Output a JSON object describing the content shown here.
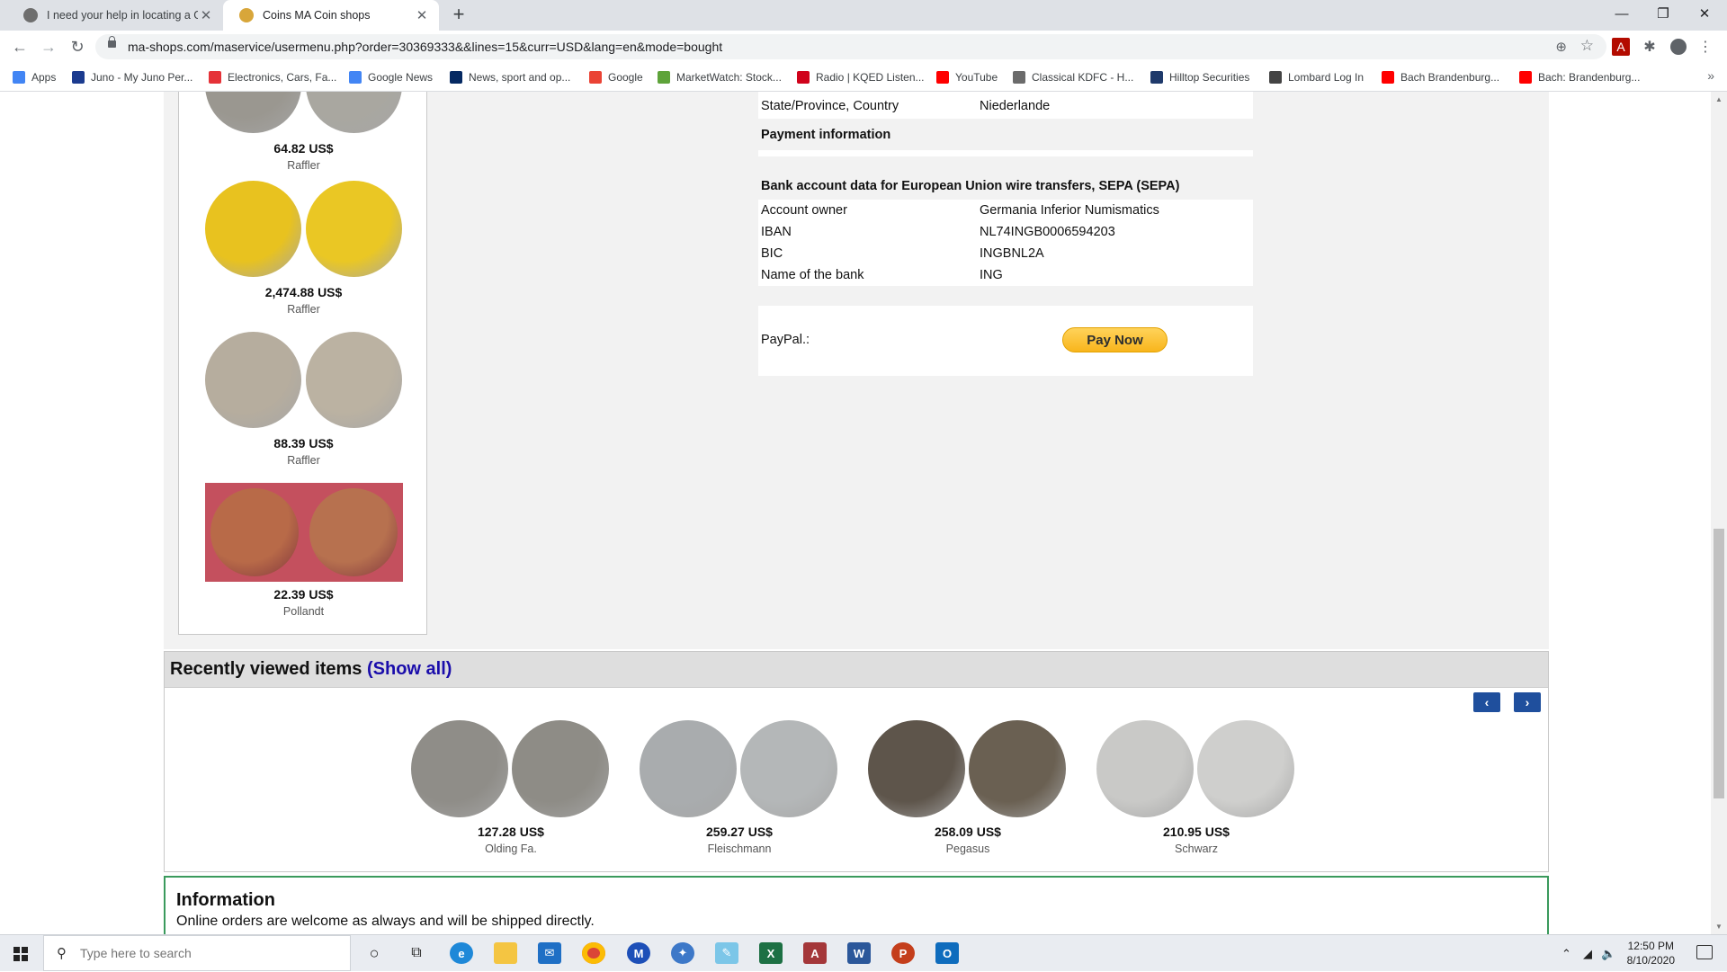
{
  "browser": {
    "tabs": [
      {
        "title": "I need your help in locating a Ge",
        "active": false
      },
      {
        "title": "Coins MA Coin shops",
        "active": true
      }
    ],
    "url": "ma-shops.com/maservice/usermenu.php?order=30369333&&lines=15&curr=USD&lang=en&mode=bought",
    "bookmarks": [
      {
        "label": "Apps",
        "icon": "apps-grid-icon",
        "color": "#4285f4"
      },
      {
        "label": "Juno - My Juno Per...",
        "icon": "juno-icon",
        "color": "#1b3b8f"
      },
      {
        "label": "Electronics, Cars, Fa...",
        "icon": "bag-icon",
        "color": "#e53238"
      },
      {
        "label": "Google News",
        "icon": "google-news-icon",
        "color": "#4285f4"
      },
      {
        "label": "News, sport and op...",
        "icon": "guardian-icon",
        "color": "#052962"
      },
      {
        "label": "Google",
        "icon": "google-icon",
        "color": "#ea4335"
      },
      {
        "label": "MarketWatch: Stock...",
        "icon": "marketwatch-icon",
        "color": "#5ea33a"
      },
      {
        "label": "Radio | KQED Listen...",
        "icon": "kqed-icon",
        "color": "#d0021b"
      },
      {
        "label": "YouTube",
        "icon": "youtube-icon",
        "color": "#ff0000"
      },
      {
        "label": "Classical KDFC - H...",
        "icon": "radio-icon",
        "color": "#6b6b6b"
      },
      {
        "label": "Hilltop Securities",
        "icon": "hilltop-icon",
        "color": "#1f3a6b"
      },
      {
        "label": "Lombard Log In",
        "icon": "lombard-icon",
        "color": "#444444"
      },
      {
        "label": "Bach Brandenburg...",
        "icon": "youtube-icon",
        "color": "#ff0000"
      },
      {
        "label": "Bach: Brandenburg...",
        "icon": "youtube-icon",
        "color": "#ff0000"
      }
    ]
  },
  "sidebar": {
    "items": [
      {
        "price": "64.82 US$",
        "seller": "Raffler",
        "c1": "#9a9790",
        "c2": "#a9a7a0",
        "bg": "#ffffff"
      },
      {
        "price": "2,474.88 US$",
        "seller": "Raffler",
        "c1": "#e8c21f",
        "c2": "#eac724",
        "bg": "#ffffff"
      },
      {
        "price": "88.39 US$",
        "seller": "Raffler",
        "c1": "#b6ad9e",
        "c2": "#bbb2a2",
        "bg": "#ffffff"
      },
      {
        "price": "22.39 US$",
        "seller": "Pollandt",
        "c1": "#b86a48",
        "c2": "#b7714f",
        "bg": "#c4505e"
      }
    ]
  },
  "order": {
    "state_label": "State/Province, Country",
    "state_value": "Niederlande",
    "payment_info_label": "Payment information",
    "bank_header": "Bank account data for European Union wire transfers, SEPA (SEPA)",
    "bank_rows": [
      {
        "label": "Account owner",
        "value": "Germania Inferior Numismatics"
      },
      {
        "label": "IBAN",
        "value": "NL74INGB0006594203"
      },
      {
        "label": "BIC",
        "value": "INGBNL2A"
      },
      {
        "label": "Name of the bank",
        "value": "ING"
      }
    ],
    "paypal_label": "PayPal.:",
    "pay_now_label": "Pay Now"
  },
  "recent": {
    "title": "Recently viewed items",
    "show_all": "(Show all)",
    "items": [
      {
        "price": "127.28 US$",
        "seller": "Olding Fa.",
        "c1": "#8f8d88",
        "c2": "#8e8c86"
      },
      {
        "price": "259.27 US$",
        "seller": "Fleischmann",
        "c1": "#a9acae",
        "c2": "#b4b7b8"
      },
      {
        "price": "258.09 US$",
        "seller": "Pegasus",
        "c1": "#5e554b",
        "c2": "#6a6052"
      },
      {
        "price": "210.95 US$",
        "seller": "Schwarz",
        "c1": "#c9c9c7",
        "c2": "#cfcfcd"
      }
    ]
  },
  "info": {
    "title": "Information",
    "text": "Online orders are welcome as always and will be shipped directly."
  },
  "taskbar": {
    "search_placeholder": "Type here to search",
    "time": "12:50 PM",
    "date": "8/10/2020"
  }
}
